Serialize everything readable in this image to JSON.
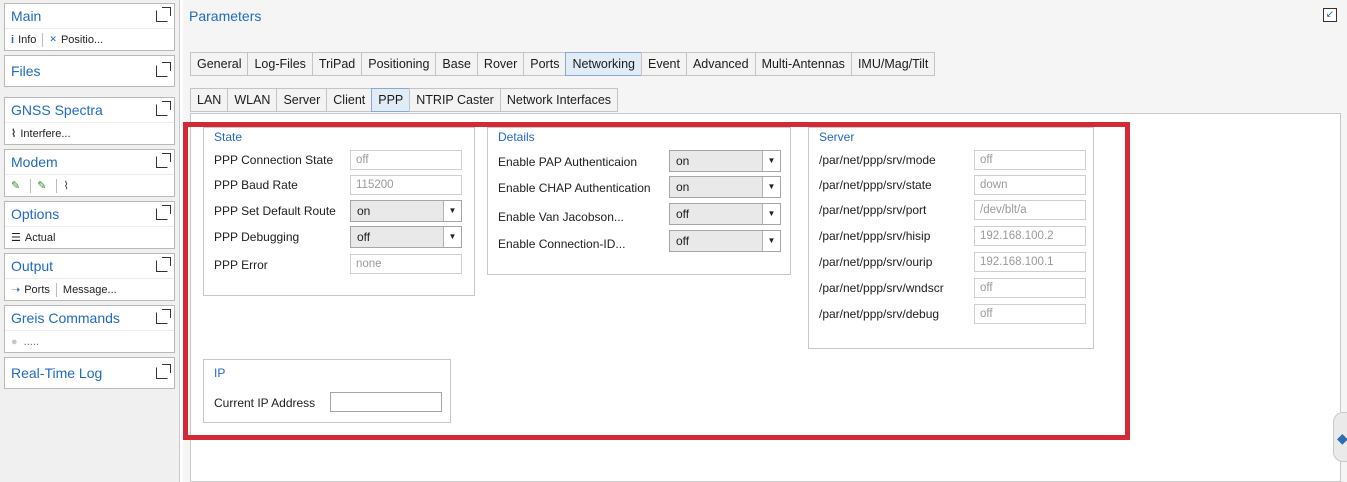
{
  "sidebar": {
    "panels": [
      {
        "title": "Main",
        "items": [
          {
            "icon": "info-icon",
            "glyph": "i",
            "label": "Info"
          },
          {
            "icon": "satellite-icon",
            "glyph": "✕",
            "label": "Positio..."
          }
        ]
      },
      {
        "title": "Files",
        "items": []
      },
      {
        "title": "GNSS Spectra",
        "items": [
          {
            "icon": "chart-icon",
            "glyph": "⌇",
            "label": "Interfere..."
          }
        ]
      },
      {
        "title": "Modem",
        "items": [
          {
            "icon": "link-icon",
            "glyph": "✎"
          },
          {
            "icon": "link-alt-icon",
            "glyph": "✎"
          },
          {
            "icon": "chart-icon",
            "glyph": "⌇"
          }
        ]
      },
      {
        "title": "Options",
        "items": [
          {
            "icon": "list-icon",
            "glyph": "☰",
            "label": "Actual"
          }
        ]
      },
      {
        "title": "Output",
        "items": [
          {
            "icon": "arrow-icon",
            "glyph": "➝",
            "label": "Ports"
          },
          {
            "label": "Message..."
          }
        ]
      },
      {
        "title": "Greis Commands",
        "items": [
          {
            "icon": "circle-icon",
            "glyph": "●",
            "label": "....."
          }
        ]
      },
      {
        "title": "Real-Time Log",
        "items": []
      }
    ]
  },
  "main": {
    "title": "Parameters",
    "tabs_row1": [
      "General",
      "Log-Files",
      "TriPad",
      "Positioning",
      "Base",
      "Rover",
      "Ports",
      "Networking",
      "Event",
      "Advanced",
      "Multi-Antennas",
      "IMU/Mag/Tilt"
    ],
    "tabs_row1_active": "Networking",
    "tabs_row2": [
      "LAN",
      "WLAN",
      "Server",
      "Client",
      "PPP",
      "NTRIP Caster",
      "Network Interfaces"
    ],
    "tabs_row2_active": "PPP"
  },
  "state": {
    "title": "State",
    "connection_state_label": "PPP Connection State",
    "connection_state_value": "off",
    "baud_rate_label": "PPP Baud Rate",
    "baud_rate_value": "115200",
    "default_route_label": "PPP Set Default Route",
    "default_route_value": "on",
    "debugging_label": "PPP Debugging",
    "debugging_value": "off",
    "error_label": "PPP Error",
    "error_value": "none"
  },
  "details": {
    "title": "Details",
    "pap_label": "Enable PAP Authenticaion",
    "pap_value": "on",
    "chap_label": "Enable CHAP Authentication",
    "chap_value": "on",
    "vj_label": "Enable Van Jacobson...",
    "vj_value": "off",
    "connid_label": "Enable Connection-ID...",
    "connid_value": "off"
  },
  "server": {
    "title": "Server",
    "rows": [
      {
        "label": "/par/net/ppp/srv/mode",
        "value": "off"
      },
      {
        "label": "/par/net/ppp/srv/state",
        "value": "down"
      },
      {
        "label": "/par/net/ppp/srv/port",
        "value": "/dev/blt/a"
      },
      {
        "label": "/par/net/ppp/srv/hisip",
        "value": "192.168.100.2"
      },
      {
        "label": "/par/net/ppp/srv/ourip",
        "value": "192.168.100.1"
      },
      {
        "label": "/par/net/ppp/srv/wndscr",
        "value": "off"
      },
      {
        "label": "/par/net/ppp/srv/debug",
        "value": "off"
      }
    ]
  },
  "ip": {
    "title": "IP",
    "current_ip_label": "Current IP Address",
    "current_ip_value": ""
  },
  "colors": {
    "accent": "#1f6ac2",
    "highlight": "#d42a36"
  }
}
